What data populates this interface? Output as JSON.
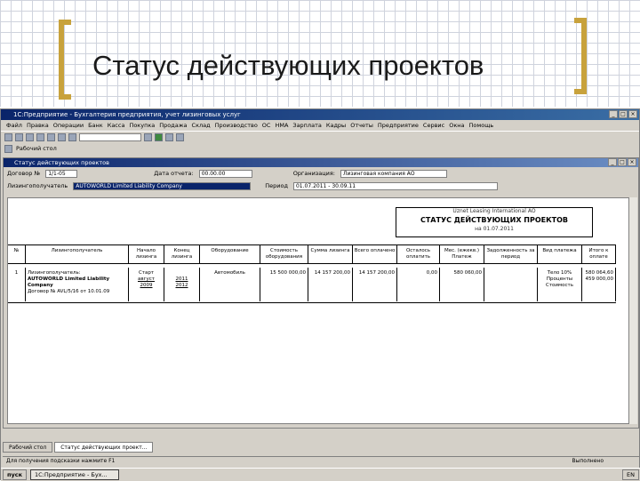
{
  "slide": {
    "title": "Статус действующих проектов"
  },
  "app": {
    "title": "1С:Предприятие - Бухгалтерия предприятия, учет лизинговых услуг",
    "menu": [
      "Файл",
      "Правка",
      "Операции",
      "Банк",
      "Касса",
      "Покупка",
      "Продажа",
      "Склад",
      "Производство",
      "ОС",
      "НМА",
      "Зарплата",
      "Кадры",
      "Отчеты",
      "Предприятие",
      "Сервис",
      "Окна",
      "Помощь"
    ],
    "toolbar2_label": "Рабочий стол"
  },
  "doc": {
    "title": "Статус действующих проектов",
    "contract_label": "Договор №",
    "contract_value": "1/1-05",
    "date_label": "Дата отчета:",
    "date_value": "00.00.00",
    "org_label": "Организация:",
    "org_value": "Лизинговая компания АО",
    "lessee_label": "Лизингополучатель",
    "lessee_value": "AUTOWORLD Limited Liability Company",
    "period_label": "Период",
    "period_value": "01.07.2011 - 30.09.11"
  },
  "report": {
    "org": "Uznet Leasing International AO",
    "title": "СТАТУС ДЕЙСТВУЮЩИХ ПРОЕКТОВ",
    "date": "на 01.07.2011"
  },
  "table": {
    "headers": [
      "№",
      "Лизингополучатель",
      "Начало лизинга",
      "Конец лизинга",
      "Оборудование",
      "Стоимость оборудования",
      "Сумма лизинга",
      "Всего оплачено",
      "Осталось оплатить",
      "Мес. (ежекв.) Платеж",
      "Задолженность за период",
      "Вид платежа",
      "Итого к оплате"
    ],
    "row": {
      "num": "1",
      "lessee_line1": "Лизингополучатель:",
      "lessee_line2": "AUTOWORLD Limited Liability Company",
      "lessee_line3": "Договор № AVL/5/16 от 10.01.09",
      "start_top": "Старт",
      "start": "август",
      "start_year": "2009",
      "end": "2011",
      "end_year": "2012",
      "equipment": "Автомобиль",
      "cost": "15 500 000,00",
      "lease_sum": "14 157 200,00",
      "paid": "14 157 200,00",
      "left": "0,00",
      "monthly": "580 060,00",
      "debt": "",
      "pay_type": "Тело 10% Проценты Стоимость",
      "total1": "580 064,60",
      "total2": "459 000,00"
    }
  },
  "bottom_tabs": [
    "Рабочий стол",
    "Статус действующих проект..."
  ],
  "status_text": "Для получения подсказки нажмите F1",
  "status_right": "Выполнено",
  "taskbar": {
    "start": "пуск",
    "task": "1С:Предприятие - Бух...",
    "clock": "EN"
  }
}
